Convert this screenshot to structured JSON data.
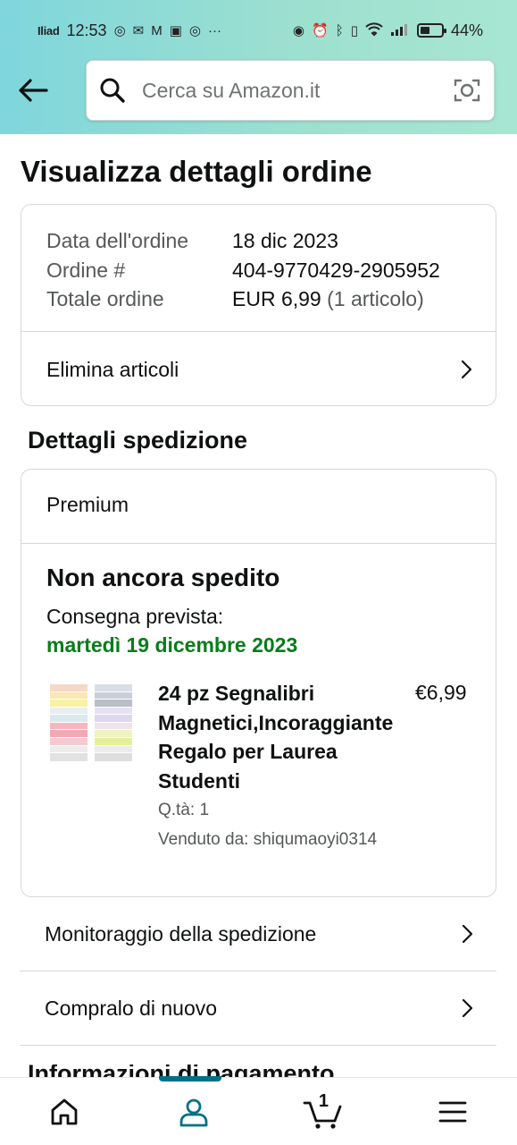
{
  "status_bar": {
    "carrier": "Iliad",
    "time": "12:53",
    "notification_icons": [
      "instagram-icon",
      "mail-icon",
      "gmail-icon",
      "news-icon",
      "instagram-icon"
    ],
    "more": "···",
    "battery": "44%"
  },
  "header": {
    "search_placeholder": "Cerca su Amazon.it"
  },
  "page": {
    "title": "Visualizza dettagli ordine"
  },
  "order_summary": {
    "date_label": "Data dell'ordine",
    "date_value": "18 dic 2023",
    "order_label": "Ordine #",
    "order_value": "404-9770429-2905952",
    "total_label": "Totale ordine",
    "total_value": "EUR 6,99",
    "total_items": "(1 articolo)",
    "remove_items": "Elimina articoli"
  },
  "shipment": {
    "section_title": "Dettagli spedizione",
    "type": "Premium",
    "status": "Non ancora spedito",
    "delivery_label": "Consegna prevista:",
    "delivery_date": "martedì 19 dicembre 2023",
    "item": {
      "title": "24 pz Segnalibri Magnetici,Incoraggiante Regalo per Laurea Studenti",
      "price": "€6,99",
      "quantity": "Q.tà: 1",
      "seller": "Venduto da: shiqumaoyi0314"
    }
  },
  "actions": {
    "track": "Monitoraggio della spedizione",
    "buy_again": "Compralo di nuovo"
  },
  "partial_section": "Informazioni di pagamento",
  "bottom_nav": {
    "cart_count": "1",
    "active": "account",
    "accent_color": "#007185"
  },
  "colors": {
    "delivery_green": "#067d1a",
    "header_gradient_start": "#7fd6dc",
    "header_gradient_end": "#a7e6d2"
  }
}
